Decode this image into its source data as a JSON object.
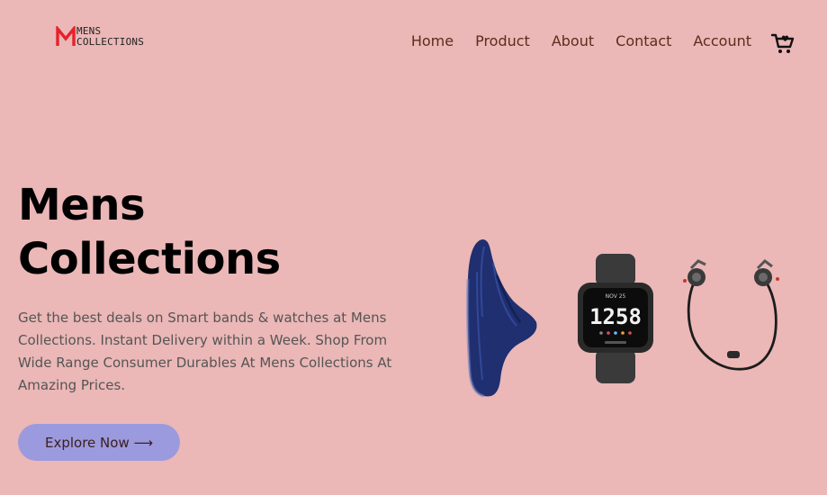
{
  "brand": {
    "logo_letter": "M",
    "line1": "MENS",
    "line2": "COLLECTIONS"
  },
  "nav": {
    "items": [
      "Home",
      "Product",
      "About",
      "Contact",
      "Account"
    ]
  },
  "cart_icon": "cart-icon",
  "hero": {
    "title_line1": "Mens",
    "title_line2": "Collections",
    "description": "Get the best deals on Smart bands & watches at Mens Collections. Instant Delivery within a Week. Shop From Wide Range Consumer Durables At Mens Collections At Amazing Prices.",
    "cta_label": "Explore Now ⟶",
    "watch_time": "1258",
    "watch_date": "NOV 25"
  },
  "colors": {
    "background": "#ebb7b7",
    "nav_text": "#5a2e1b",
    "cta_background": "#9c9ade",
    "logo_red": "#e3232c"
  }
}
